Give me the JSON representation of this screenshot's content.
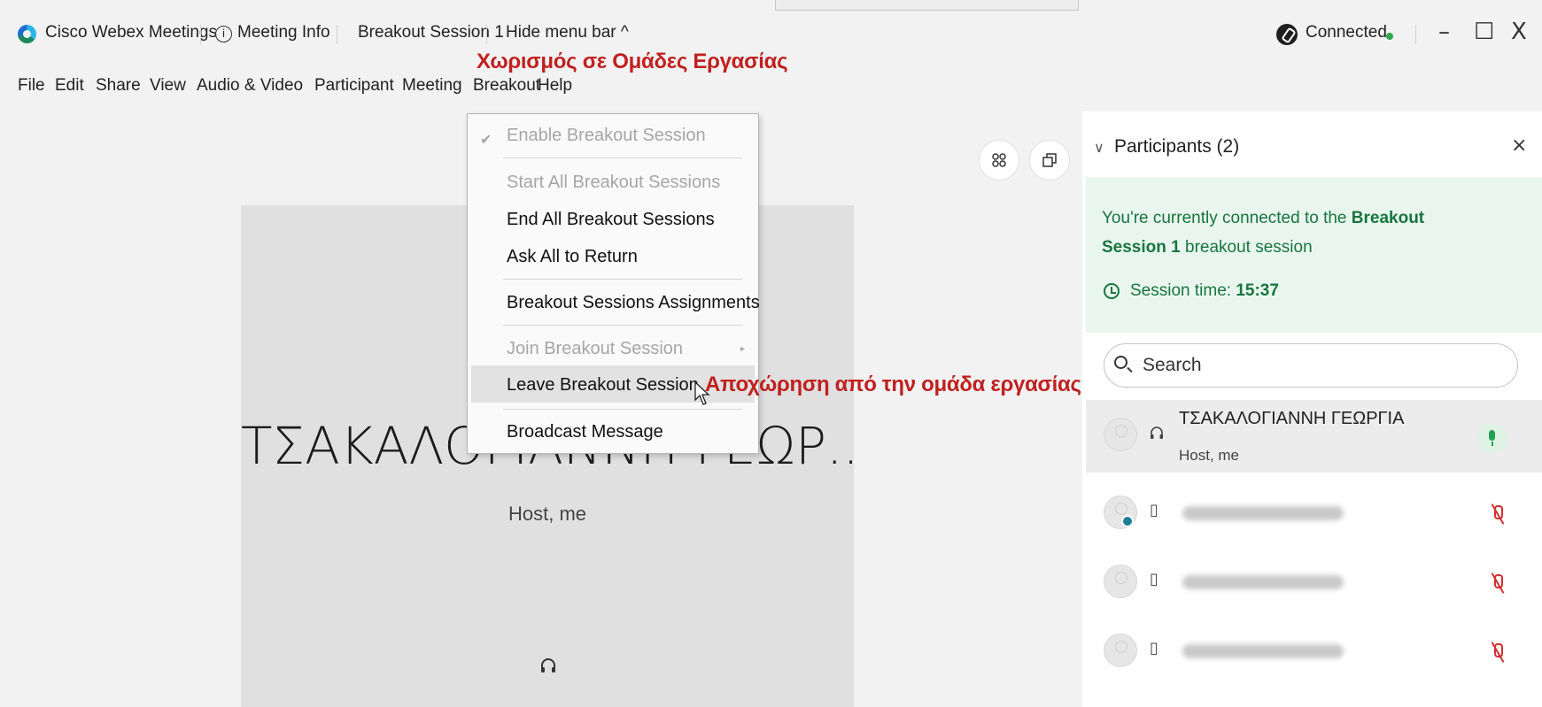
{
  "titlebar": {
    "app_name": "Cisco Webex Meetings",
    "meeting_info": "Meeting Info",
    "breakout_session": "Breakout Session 1",
    "hide_menu_bar": "Hide menu bar ^",
    "connection_status": "Connected",
    "connection_color": "#2fa84f",
    "minimize": "–",
    "maximize": "☐",
    "close": "X"
  },
  "menu": {
    "file": "File",
    "edit": "Edit",
    "share": "Share",
    "view": "View",
    "audio_video": "Audio & Video",
    "participant": "Participant",
    "meeting": "Meeting",
    "breakout": "Breakout",
    "help": "Help"
  },
  "annotations": {
    "breakout_label": "Χωρισμός σε Ομάδες Εργασίας",
    "leave_label": "Αποχώρηση από την ομάδα εργασίας",
    "color": "#c0201f"
  },
  "breakout_menu": {
    "items": [
      {
        "label": "Enable Breakout Session",
        "enabled": false,
        "checked": true
      },
      {
        "label": "Start All Breakout Sessions",
        "enabled": false
      },
      {
        "label": "End All Breakout Sessions",
        "enabled": true
      },
      {
        "label": "Ask All to Return",
        "enabled": true
      },
      {
        "label": "Breakout Sessions Assignments",
        "enabled": true
      },
      {
        "label": "Join Breakout Session",
        "enabled": false,
        "submenu": true
      },
      {
        "label": "Leave Breakout Session",
        "enabled": true,
        "hovered": true
      },
      {
        "label": "Broadcast Message",
        "enabled": true
      }
    ]
  },
  "stage": {
    "name": "ΤΣΑΚΑΛΟΓΙΑΝΝΗ ΓΕΩΡ...",
    "role": "Host, me",
    "grid_icon": "grid-view-icon",
    "popout_icon": "popout-icon"
  },
  "participants": {
    "title": "Participants (2)",
    "notice_prefix": "You're currently connected to the ",
    "notice_session": "Breakout Session 1",
    "notice_suffix": " breakout session",
    "session_time_label": "Session time: ",
    "session_time_value": "15:37",
    "search_placeholder": "Search",
    "accent_color": "#18753f",
    "host": {
      "name": "ΤΣΑΚΑΛΟΓΙΑΝΝΗ ΓΕΩΡΓΙΑ",
      "role": "Host, me",
      "device_icon": "headset-icon",
      "mic": "unmuted"
    },
    "others": [
      {
        "device_icon": "phone-icon",
        "mic": "muted",
        "name_blurred": true
      },
      {
        "device_icon": "phone-icon",
        "mic": "muted",
        "name_blurred": true
      },
      {
        "device_icon": "phone-icon",
        "mic": "muted",
        "name_blurred": true
      }
    ]
  }
}
